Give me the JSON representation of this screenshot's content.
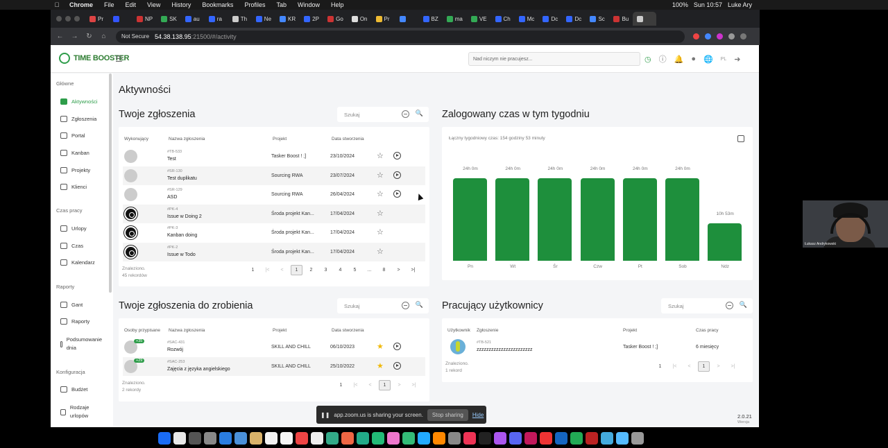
{
  "macmenu": {
    "app": "Chrome",
    "items": [
      "File",
      "Edit",
      "View",
      "History",
      "Bookmarks",
      "Profiles",
      "Tab",
      "Window",
      "Help"
    ],
    "battery": "100%",
    "clock": "Sun 10:57",
    "user": "Luke Ary"
  },
  "browser": {
    "tabs": [
      "Pr",
      "",
      "NP",
      "SK",
      "au",
      "ra",
      "Th",
      "Ne",
      "KR",
      "2P",
      "Go",
      "On",
      "Pr",
      "",
      "BZ",
      "ma",
      "VE",
      "Ch",
      "Mc",
      "Dc",
      "Dc",
      "Sc",
      "Bu",
      ""
    ],
    "not_secure": "Not Secure",
    "url_host": "54.38.138.95",
    "url_rest": ":21500/#/activity"
  },
  "app": {
    "logo": "TIME BOOSTER",
    "current_task": "Nad niczym nie pracujesz...",
    "lang": "PL",
    "version": "2.0.21",
    "version_label": "Wersja"
  },
  "sidebar": {
    "sections": [
      {
        "title": "Główne",
        "items": [
          "Aktywności",
          "Zgłoszenia",
          "Portal",
          "Kanban",
          "Projekty",
          "Klienci"
        ]
      },
      {
        "title": "Czas pracy",
        "items": [
          "Urlopy",
          "Czas",
          "Kalendarz"
        ]
      },
      {
        "title": "Raporty",
        "items": [
          "Gant",
          "Raporty",
          "Podsumowanie dnia"
        ]
      },
      {
        "title": "Konfiguracja",
        "items": [
          "Budżet",
          "Rodzaje urlopów"
        ]
      }
    ]
  },
  "page_title": "Aktywności",
  "my_tickets": {
    "title": "Twoje zgłoszenia",
    "search_placeholder": "Szukaj",
    "headers": [
      "Wykonujący",
      "Nazwa zgłoszenia",
      "Projekt",
      "Data stworzenia"
    ],
    "rows": [
      {
        "code": "#TB-533",
        "name": "Test",
        "project": "Tasker Boost ! ;]",
        "date": "23/10/2024",
        "avatar": "grey",
        "play": true
      },
      {
        "code": "#SR-130",
        "name": "Test duplikatu",
        "project": "Sourcing RWA",
        "date": "23/07/2024",
        "avatar": "grey",
        "play": true
      },
      {
        "code": "#SR-129",
        "name": "ASD",
        "project": "Sourcing RWA",
        "date": "26/04/2024",
        "avatar": "grey",
        "play": true
      },
      {
        "code": "#PK-4",
        "name": "Issue w Doing 2",
        "project": "Środa projekt Kan...",
        "date": "17/04/2024",
        "avatar": "dark",
        "play": false
      },
      {
        "code": "#PK-3",
        "name": "Kanban doing",
        "project": "Środa projekt Kan...",
        "date": "17/04/2024",
        "avatar": "dark",
        "play": false
      },
      {
        "code": "#PK-2",
        "name": "Issue w Todo",
        "project": "Środa projekt Kan...",
        "date": "17/04/2024",
        "avatar": "dark",
        "play": false
      }
    ],
    "found_label": "Znaleziono.",
    "found_count": "45 rekordów",
    "pager": {
      "per_page": "1",
      "pages": [
        "1",
        "2",
        "3",
        "4",
        "5",
        "...",
        "8"
      ]
    }
  },
  "todo": {
    "title": "Twoje zgłoszenia do zrobienia",
    "search_placeholder": "Szukaj",
    "headers": [
      "Osoby przypisane",
      "Nazwa zgłoszenia",
      "Projekt",
      "Data stworzenia"
    ],
    "rows": [
      {
        "code": "#SAC-431",
        "name": "Rozwój",
        "project": "SKILL AND CHILL",
        "date": "06/10/2023",
        "badge": "+35"
      },
      {
        "code": "#SAC-253",
        "name": "Zajęcia z języka angielskiego",
        "project": "SKILL AND CHILL",
        "date": "25/10/2022",
        "badge": "+29"
      }
    ],
    "found_label": "Znaleziono.",
    "found_count": "2 rekordy",
    "pager": {
      "per_page": "1",
      "current": "1"
    }
  },
  "weekly": {
    "title": "Zalogowany czas w tym tygodniu",
    "total_label": "Łączny tygodniowy czas: 154 godziny 53 minuty"
  },
  "chart_data": {
    "type": "bar",
    "categories": [
      "Pn",
      "Wt",
      "Śr",
      "Czw",
      "Pt",
      "Sob",
      "Ndz"
    ],
    "values": [
      24,
      24,
      24,
      24,
      24,
      24,
      10.883
    ],
    "data_labels": [
      "24h 0m",
      "24h 0m",
      "24h 0m",
      "24h 0m",
      "24h 0m",
      "24h 0m",
      "10h 53m"
    ],
    "ylim": [
      0,
      24
    ],
    "color": "#1e8f3c",
    "grid": false
  },
  "working": {
    "title": "Pracujący użytkownicy",
    "search_placeholder": "Szukaj",
    "headers": [
      "Użytkownik",
      "Zgłoszenie",
      "Projekt",
      "Czas pracy"
    ],
    "rows": [
      {
        "code": "#TB-521",
        "name": "zzzzzzzzzzzzzzzzzzzzzzz",
        "project": "Tasker Boost ! ;]",
        "time": "6 miesięcy"
      }
    ],
    "found_label": "Znaleziono.",
    "found_count": "1 rekord",
    "pager": {
      "per_page": "1",
      "current": "1"
    }
  },
  "zoom": {
    "msg": "app.zoom.us is sharing your screen.",
    "stop": "Stop sharing",
    "hide": "Hide"
  },
  "webcam": {
    "name": "Łukasz Andrykowski"
  }
}
